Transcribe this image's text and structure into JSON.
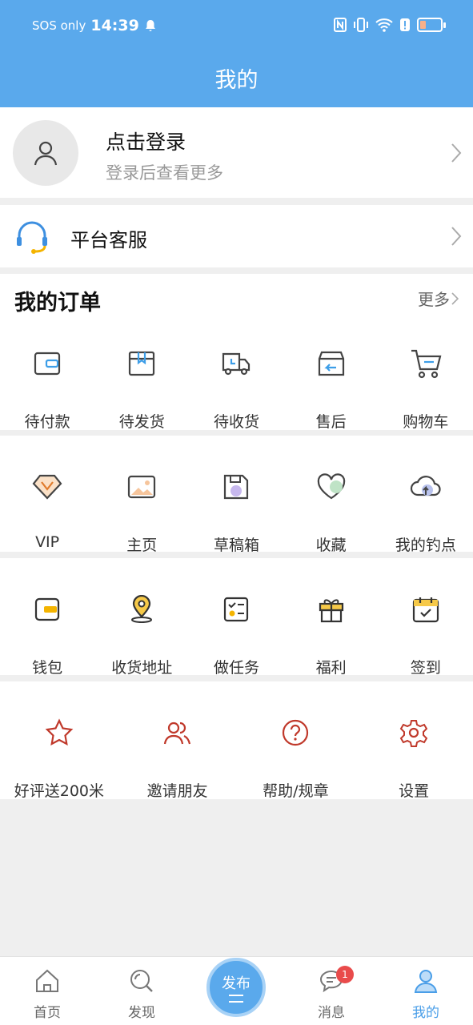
{
  "status_bar": {
    "carrier": "SOS only",
    "time": "14:39"
  },
  "header": {
    "title": "我的"
  },
  "login": {
    "title": "点击登录",
    "subtitle": "登录后查看更多"
  },
  "service": {
    "label": "平台客服"
  },
  "orders": {
    "title": "我的订单",
    "more": "更多",
    "items": [
      {
        "label": "待付款",
        "icon": "wallet-icon"
      },
      {
        "label": "待发货",
        "icon": "box-icon"
      },
      {
        "label": "待收货",
        "icon": "truck-icon"
      },
      {
        "label": "售后",
        "icon": "return-box-icon"
      },
      {
        "label": "购物车",
        "icon": "cart-icon"
      }
    ]
  },
  "row2": {
    "items": [
      {
        "label": "VIP",
        "icon": "vip-diamond-icon"
      },
      {
        "label": "主页",
        "icon": "image-icon"
      },
      {
        "label": "草稿箱",
        "icon": "draft-icon"
      },
      {
        "label": "收藏",
        "icon": "heart-icon"
      },
      {
        "label": "我的钓点",
        "icon": "cloud-upload-icon"
      }
    ]
  },
  "row3": {
    "items": [
      {
        "label": "钱包",
        "icon": "wallet-yellow-icon"
      },
      {
        "label": "收货地址",
        "icon": "location-pin-icon"
      },
      {
        "label": "做任务",
        "icon": "task-list-icon"
      },
      {
        "label": "福利",
        "icon": "gift-icon"
      },
      {
        "label": "签到",
        "icon": "calendar-check-icon"
      }
    ]
  },
  "row4": {
    "items": [
      {
        "label": "好评送200米",
        "icon": "star-icon"
      },
      {
        "label": "邀请朋友",
        "icon": "friends-icon"
      },
      {
        "label": "帮助/规章",
        "icon": "help-icon"
      },
      {
        "label": "设置",
        "icon": "settings-icon"
      }
    ]
  },
  "tabbar": {
    "items": [
      {
        "label": "首页",
        "icon": "home-icon"
      },
      {
        "label": "发现",
        "icon": "discover-icon"
      },
      {
        "label": "发布",
        "icon": "publish-icon"
      },
      {
        "label": "消息",
        "icon": "message-icon",
        "badge": "1"
      },
      {
        "label": "我的",
        "icon": "profile-icon"
      }
    ]
  },
  "colors": {
    "primary": "#5aa9ec",
    "active_tab": "#4a9ee8",
    "badge": "#e94b4b",
    "accent_red": "#c0392b"
  }
}
